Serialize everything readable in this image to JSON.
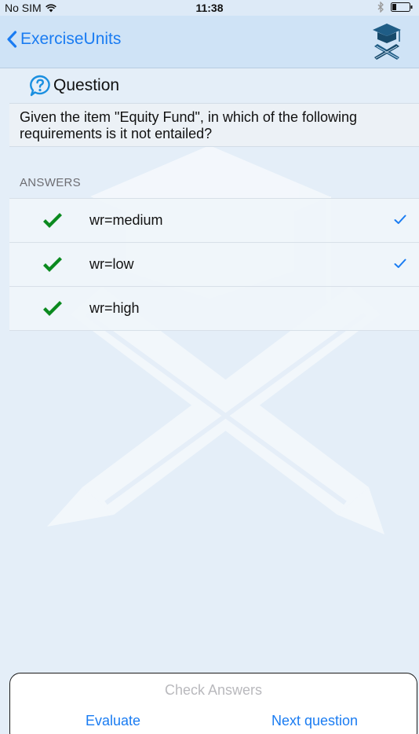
{
  "status_bar": {
    "carrier": "No SIM",
    "time": "11:38"
  },
  "nav": {
    "back_label": "ExerciseUnits",
    "logo_icon": "graduation-cap-pencils-icon"
  },
  "question": {
    "title": "Question",
    "text": "Given the item \"Equity Fund\", in which of the following requirements is it not entailed?"
  },
  "answers": {
    "header": "ANSWERS",
    "items": [
      {
        "label": "wr=medium",
        "selected": true
      },
      {
        "label": "wr=low",
        "selected": true
      },
      {
        "label": "wr=high",
        "selected": false
      }
    ]
  },
  "actions": {
    "check_answers": "Check Answers",
    "evaluate": "Evaluate",
    "next_question": "Next question"
  },
  "colors": {
    "accent": "#1a7cf2",
    "correct": "#0b8a1f",
    "nav_bg": "#cfe3f6",
    "content_bg": "#e4eef8"
  }
}
